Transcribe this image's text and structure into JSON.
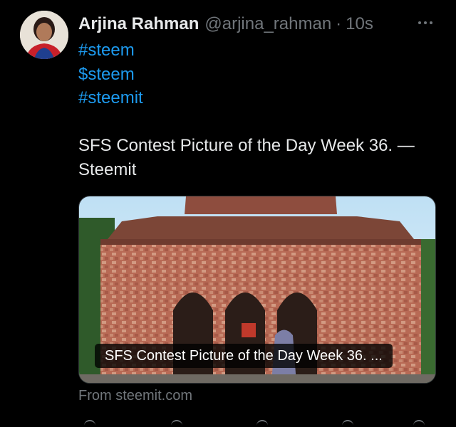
{
  "tweet": {
    "author_name": "Arjina Rahman",
    "author_handle": "@arjina_rahman",
    "separator": "·",
    "timestamp": "10s",
    "hashtags": [
      "#steem",
      "$steem",
      "#steemit"
    ],
    "text": "SFS Contest Picture of the Day Week 36. — Steemit"
  },
  "link_card": {
    "title": "SFS Contest Picture of the Day Week 36. ...",
    "source": "From steemit.com"
  },
  "icons": {
    "more": "more-options-icon"
  },
  "colors": {
    "background": "#000000",
    "text": "#e7e9ea",
    "muted": "#71767b",
    "link": "#1d9bf0"
  }
}
